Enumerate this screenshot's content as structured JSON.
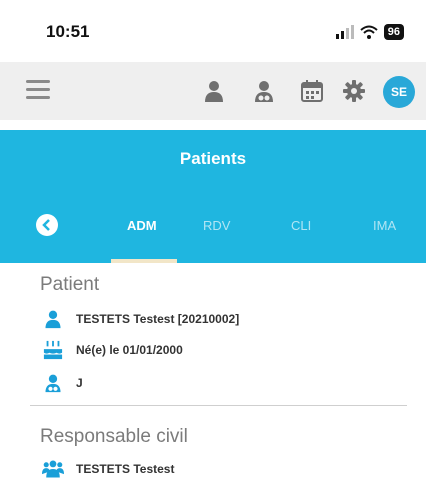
{
  "status_bar": {
    "time": "10:51",
    "battery": "96"
  },
  "toolbar": {
    "icons": [
      "patient-icon",
      "doctor-icon",
      "calendar-icon",
      "gear-icon"
    ],
    "avatar_initials": "SE"
  },
  "header": {
    "title": "Patients"
  },
  "tabs": [
    {
      "label": "ADM",
      "active": true
    },
    {
      "label": "RDV",
      "active": false
    },
    {
      "label": "CLI",
      "active": false
    },
    {
      "label": "IMA",
      "active": false
    }
  ],
  "patient_section": {
    "title": "Patient",
    "name": "TESTETS Testest [20210002]",
    "birth": "Né(e) le 01/01/2000",
    "doctor": "J"
  },
  "responsable_section": {
    "title": "Responsable civil",
    "name": "TESTETS Testest"
  },
  "colors": {
    "accent": "#1fb6e0",
    "icon_blue": "#1a9fd8",
    "toolbar_bg": "#efefef"
  }
}
